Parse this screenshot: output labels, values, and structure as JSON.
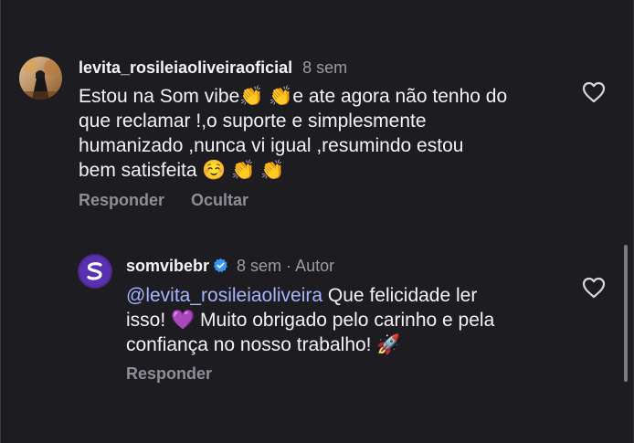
{
  "main_comment": {
    "username": "levita_rosileiaoliveiraoficial",
    "time": "8 sem",
    "text_line1_pre": "Estou na Som vibe",
    "text_line1_post": "e ate agora não tenho do",
    "text_line2": "que reclamar !,o suporte e simplesmente",
    "text_line3": "humanizado ,nunca vi igual ,resumindo estou",
    "text_line4": "bem satisfeita",
    "reply_label": "Responder",
    "hide_label": "Ocultar"
  },
  "reply_comment": {
    "username": "somvibebr",
    "meta": "8 sem · Autor",
    "mention": "@levita_rosileiaoliveira",
    "text_line1_post": " Que felicidade ler",
    "text_line2_pre": "isso!",
    "text_line2_post": "Muito obrigado pelo carinho e pela",
    "text_line3": "confiança no nosso trabalho!",
    "reply_label": "Responder"
  },
  "icons": {
    "clap": "clapping-hands-icon",
    "smile": "smiling-face-icon",
    "purple_heart": "purple-heart-icon",
    "rocket": "rocket-icon",
    "like": "heart-outline-icon",
    "verified": "verified-badge-icon"
  },
  "colors": {
    "background": "#1d1d21",
    "mention": "#a8b4ff",
    "verified": "#3897f0",
    "secondary_text": "#8e8e96",
    "brand_avatar": "#4b2a8f"
  }
}
